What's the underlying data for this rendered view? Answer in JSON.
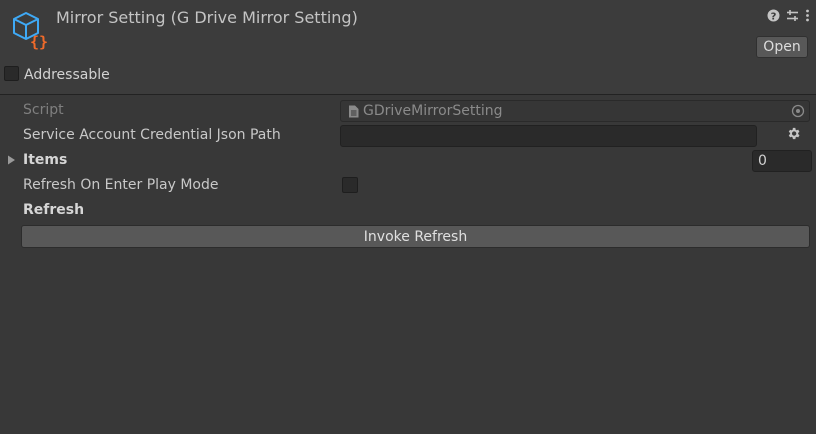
{
  "header": {
    "title": "Mirror Setting (G Drive Mirror Setting)",
    "icons": [
      "help-icon",
      "preset-icon",
      "kebab-menu-icon"
    ],
    "open_label": "Open",
    "addressable_label": "Addressable",
    "addressable_checked": false
  },
  "fields": {
    "script_label": "Script",
    "script_value": "GDriveMirrorSetting",
    "credential_label": "Service Account Credential Json Path",
    "credential_value": "",
    "items_label": "Items",
    "items_count": "0",
    "refresh_on_play_label": "Refresh On Enter Play Mode",
    "refresh_on_play_checked": false,
    "refresh_header": "Refresh",
    "invoke_refresh_label": "Invoke Refresh"
  },
  "colors": {
    "background": "#383838",
    "header_bg": "#3c3c3c",
    "icon_blue": "#3fa9f5",
    "icon_orange": "#f06a2a"
  }
}
